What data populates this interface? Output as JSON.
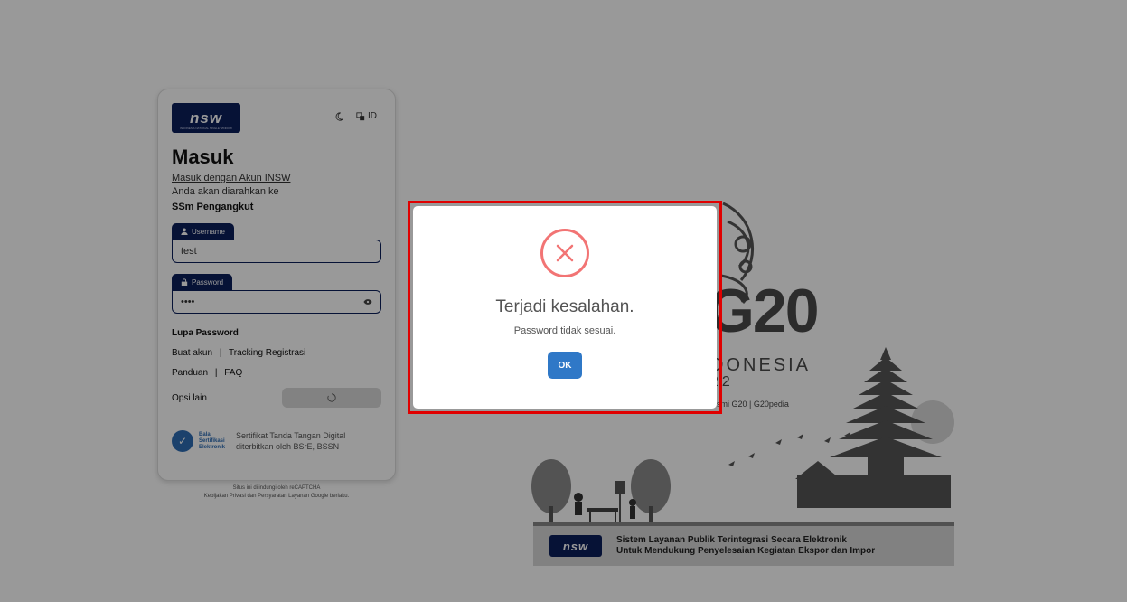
{
  "logo": {
    "text": "nsw",
    "subtext": "INDONESIA NATIONAL SINGLE WINDOW"
  },
  "header_tools": {
    "language": "ID"
  },
  "login": {
    "title": "Masuk",
    "insw_link": "Masuk dengan Akun INSW",
    "redirect_text": "Anda akan diarahkan ke",
    "app_name": "SSm Pengangkut",
    "username_label": "Username",
    "username_value": "test",
    "password_label": "Password",
    "password_value": "••••",
    "lupa_password": "Lupa Password",
    "buat_akun": "Buat akun",
    "tracking_registrasi": "Tracking Registrasi",
    "panduan": "Panduan",
    "faq": "FAQ",
    "opsi_lain": "Opsi lain",
    "separator": "|"
  },
  "bsre": {
    "name_line1": "Balai",
    "name_line2": "Sertifikasi",
    "name_line3": "Elektronik",
    "text_line1": "Sertifikat Tanda Tangan Digital",
    "text_line2": "diterbitkan oleh BSrE, BSSN"
  },
  "captcha": {
    "line1": "Situs ini dilindungi oleh reCAPTCHA",
    "line2": "Kebijakan Privasi dan Persyaratan Layanan Google berlaku."
  },
  "g20": {
    "logo_text": "G20",
    "country": "DONESIA",
    "year": "22",
    "links": "esmi G20  |  G20pedia"
  },
  "banner": {
    "line1": "Sistem Layanan Publik Terintegrasi Secara Elektronik",
    "line2": "Untuk Mendukung Penyelesaian Kegiatan Ekspor dan Impor"
  },
  "modal": {
    "title": "Terjadi kesalahan.",
    "message": "Password tidak sesuai.",
    "ok_label": "OK"
  },
  "colors": {
    "navy": "#0b1e5b",
    "error_red": "#f27474",
    "ok_blue": "#2f78c7",
    "highlight_red": "#e00000"
  }
}
